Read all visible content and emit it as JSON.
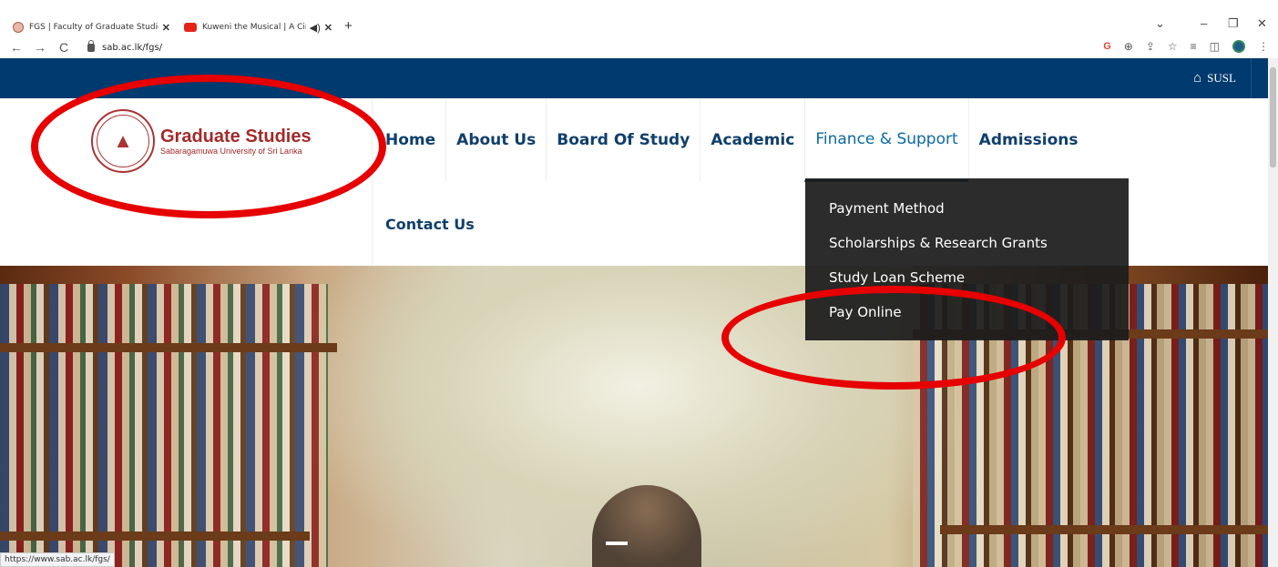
{
  "browser": {
    "tabs": [
      {
        "title": "FGS | Faculty of Graduate Studies",
        "active": true
      },
      {
        "title": "Kuweni the Musical | A Ciner",
        "active": false
      }
    ],
    "new_tab": "+",
    "url": "sab.ac.lk/fgs/",
    "status_url": "https://www.sab.ac.lk/fgs/",
    "window_controls": {
      "chevron": "⌄",
      "minimize": "–",
      "restore": "❐",
      "close": "✕"
    },
    "toolbar": {
      "google": "G",
      "zoom": "⊕",
      "share": "⇪",
      "star": "☆",
      "readlist": "≡",
      "sidepanel": "◫",
      "menu": "⋮"
    },
    "nav": {
      "back": "←",
      "forward": "→",
      "reload": "C"
    }
  },
  "site": {
    "top_link": {
      "icon": "home-icon",
      "label": "SUSL"
    },
    "logo": {
      "title": "Graduate Studies",
      "subtitle": "Sabaragamuwa University of Sri Lanka"
    },
    "menu": [
      {
        "label": "Home"
      },
      {
        "label": "About Us"
      },
      {
        "label": "Board Of Study"
      },
      {
        "label": "Academic"
      },
      {
        "label": "Finance & Support"
      },
      {
        "label": "Admissions"
      }
    ],
    "menu_second_row": {
      "label": "Contact Us"
    },
    "dropdown": [
      {
        "label": "Payment Method"
      },
      {
        "label": "Scholarships & Research Grants"
      },
      {
        "label": "Study Loan Scheme"
      },
      {
        "label": "Pay Online"
      }
    ]
  },
  "colors": {
    "topbar": "#003a6e",
    "menu_text": "#103f6b",
    "logo_red": "#a42a2a",
    "annotation_red": "#e60000",
    "dropdown_bg": "#1c1c1c"
  }
}
